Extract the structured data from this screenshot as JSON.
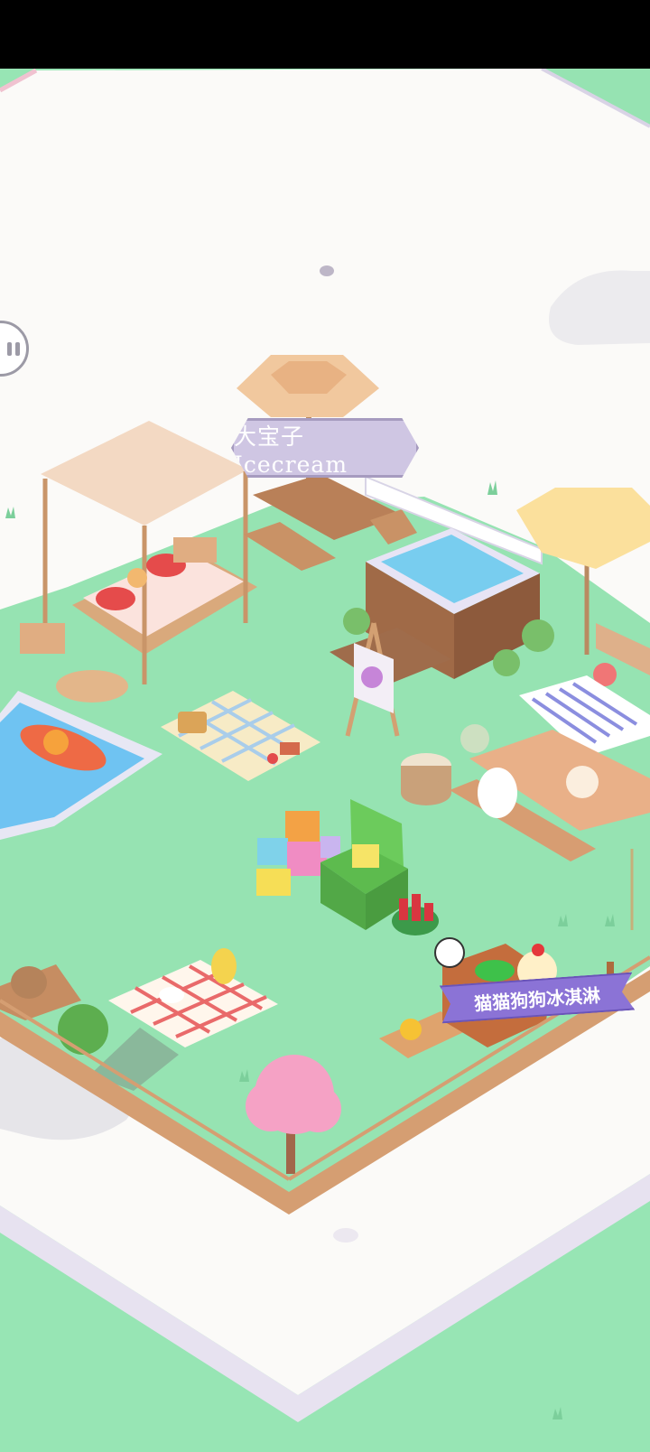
{
  "game": {
    "garden_sign": "大宝子 Icecream",
    "shop_banner": "猫猫狗狗冰淇淋"
  },
  "controls": {
    "pause_icon": "pause-icon"
  },
  "colors": {
    "lawn": "#96e3b2",
    "base": "#fbfaf8",
    "sign": "#cfc6e3",
    "banner": "#8b73d6"
  }
}
